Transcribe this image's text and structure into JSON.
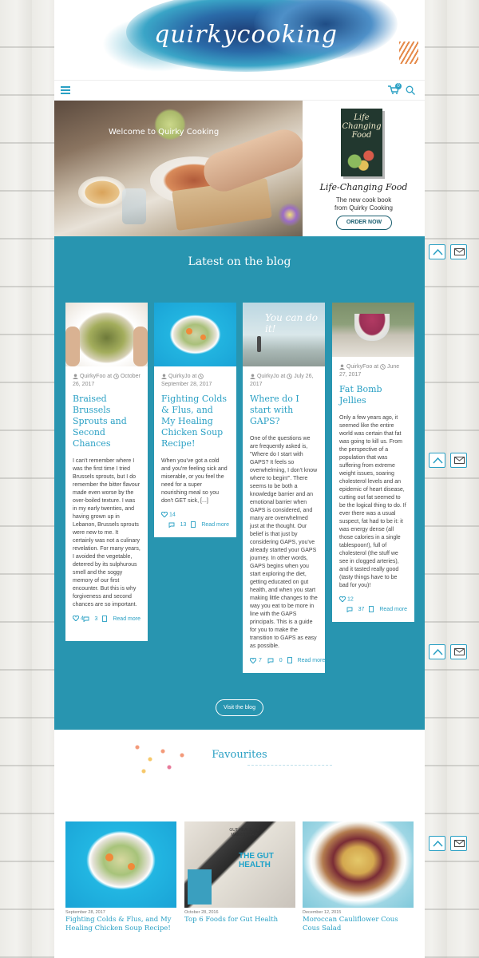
{
  "header": {
    "logo_text": "quirkycooking",
    "cart_count": "0"
  },
  "hero": {
    "overlay_text": "Welcome to Quirky Cooking",
    "book_cover_title": "Life Changing Food",
    "book_title": "Life-Changing Food",
    "book_subtitle_line1": "The new cook book",
    "book_subtitle_line2": "from Quirky Cooking",
    "order_button": "ORDER NOW"
  },
  "blog": {
    "heading": "Latest on the blog",
    "visit_button": "Visit the blog",
    "posts": [
      {
        "author": "QuirkyFoo",
        "at": "at",
        "date": "October 26, 2017",
        "title": "Braised Brussels Sprouts and Second Chances",
        "excerpt": "I can't remember where I was the first time I tried Brussels sprouts, but I do remember the bitter flavour made even worse by the over-boiled texture. I was in my early twenties, and having grown up in Lebanon, Brussels sprouts were new to me. It certainly was not a culinary revelation. For many years, I avoided the vegetable, deterred by its sulphurous smell and the soggy memory of our first encounter. But this is why forgiveness and second chances are so important.",
        "likes": "4",
        "comments": "3",
        "read_more": "Read more"
      },
      {
        "author": "QuirkyJo",
        "at": "at",
        "date": "September 28, 2017",
        "title": "Fighting Colds & Flus, and My Healing Chicken Soup Recipe!",
        "excerpt": "When you've got a cold and you're feeling sick and miserable, or you feel the need for a super nourishing meal so you don't GET sick, [...]",
        "likes": "14",
        "comments": "13",
        "read_more": "Read more"
      },
      {
        "author": "QuirkyJo",
        "at": "at",
        "date": "July 26, 2017",
        "title": "Where do I start with GAPS?",
        "excerpt": "One of the questions we are frequently asked is, \"Where do I start with GAPS? It feels so overwhelming, I don't know where to begin!\". There seems to be both a knowledge barrier and an emotional barrier when GAPS is considered, and many are overwhelmed just at the thought. Our belief is that just by considering GAPS, you've already started your GAPS journey. In other words, GAPS begins when you start exploring the diet, getting educated on gut health, and when you start making little changes to the way you eat to be more in line with the GAPS principals. This is a guide for you to make the transition to GAPS as easy as possible.",
        "likes": "7",
        "comments": "0",
        "read_more": "Read more",
        "image_text": "You can do it!"
      },
      {
        "author": "QuirkyFoo",
        "at": "at",
        "date": "June 27, 2017",
        "title": "Fat Bomb Jellies",
        "excerpt": "Only a few years ago, it seemed like the entire world was certain that fat was going to kill us. From the perspective of a population that was suffering from extreme weight issues, soaring cholesterol levels and an epidemic of heart disease, cutting out fat seemed to be the logical thing to do. If ever there was a usual suspect, fat had to be it: it was energy dense (all those calories in a single tablespoon!), full of cholesterol (the stuff we see in clogged arteries), and it tasted really good (tasty things have to be bad for you)!",
        "likes": "12",
        "comments": "37",
        "read_more": "Read more"
      }
    ]
  },
  "favourites": {
    "heading": "Favourites",
    "items": [
      {
        "date": "September 28, 2017",
        "title": "Fighting Colds & Flus, and My Healing Chicken Soup Recipe!"
      },
      {
        "date": "October 28, 2016",
        "title": "Top 6 Foods for Gut Health",
        "image_text_1": "GUT HEALTH IS MAINSTREAM",
        "image_text_2": "THE GUT HEALTH"
      },
      {
        "date": "December 12, 2015",
        "title": "Moroccan Cauliflower Cous Cous Salad"
      }
    ]
  },
  "colors": {
    "accent": "#2aa0c4",
    "blog_background": "#2895b0",
    "page_background": "#ffffff"
  },
  "icons": [
    "menu-icon",
    "cart-icon",
    "search-icon",
    "user-icon",
    "clock-icon",
    "heart-icon",
    "comment-icon",
    "document-icon",
    "arrow-up-icon",
    "envelope-icon"
  ]
}
